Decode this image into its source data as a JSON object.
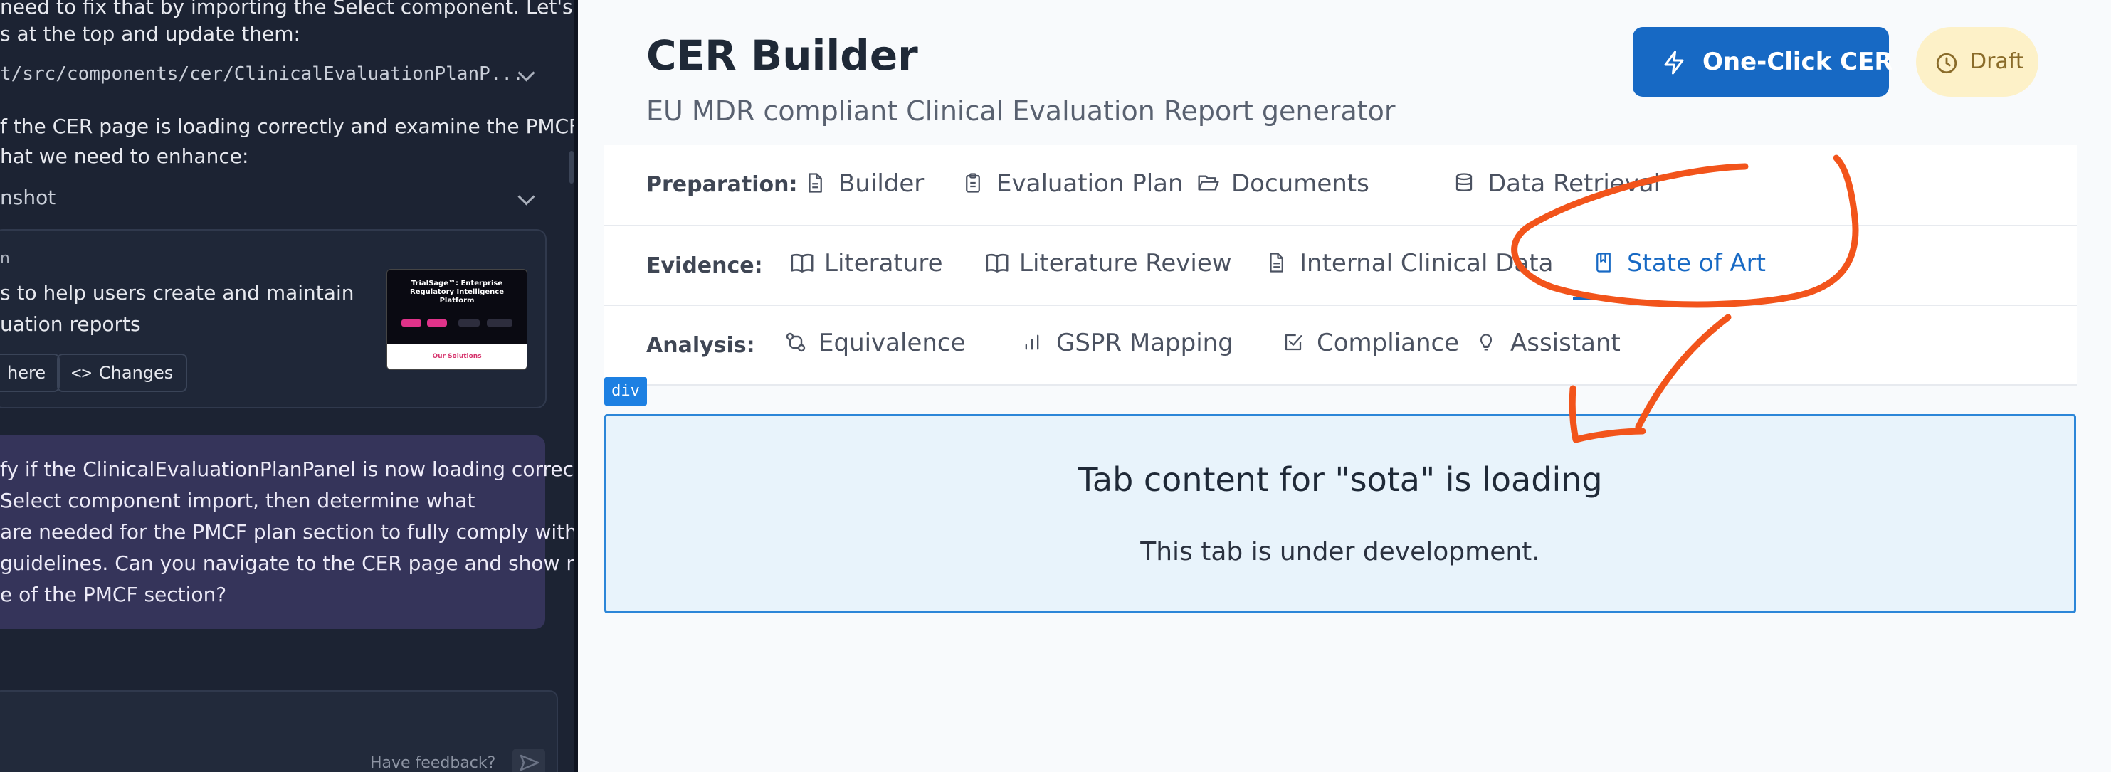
{
  "chat": {
    "line1": "need to fix that by importing the Select component. Let's",
    "line2": "s at the top and update them:",
    "file_path": "t/src/components/cer/ClinicalEvaluationPlanP...",
    "line3": "f the CER page is loading correctly and examine the PMCF",
    "line4": "hat we need to enhance:",
    "screenshot_label": "nshot",
    "card_fragment": "n",
    "card_line1": "s to help users create and maintain",
    "card_line2": "uation reports",
    "here_button": "here",
    "changes_button": "Changes",
    "thumb_title": "TrialSage™: Enterprise Regulatory Intelligence Platform",
    "thumb_footer": "Our Solutions",
    "message_lines": [
      "fy if the ClinicalEvaluationPlanPanel is now loading correctly",
      "Select component import, then determine what",
      "are needed for the PMCF plan section to fully comply with",
      "guidelines. Can you navigate to the CER page and show me",
      "e of the PMCF section?"
    ],
    "feedback": "Have feedback?"
  },
  "header": {
    "title": "CER Builder",
    "subtitle": "EU MDR compliant Clinical Evaluation Report generator",
    "one_click_label": "One-Click CER",
    "draft_label": "Draft"
  },
  "tabs": {
    "preparation": {
      "label": "Preparation:",
      "items": [
        "Builder",
        "Evaluation Plan",
        "Documents",
        "Data Retrieval"
      ]
    },
    "evidence": {
      "label": "Evidence:",
      "items": [
        "Literature",
        "Literature Review",
        "Internal Clinical Data",
        "State of Art"
      ]
    },
    "analysis": {
      "label": "Analysis:",
      "items": [
        "Equivalence",
        "GSPR Mapping",
        "Compliance",
        "Assistant"
      ]
    },
    "active": "State of Art"
  },
  "content": {
    "badge": "div",
    "heading": "Tab content for \"sota\" is loading",
    "message": "This tab is under development."
  },
  "colors": {
    "accent": "#1769c4",
    "annotation": "#f2541b",
    "draft_bg": "#fdf1c8"
  }
}
